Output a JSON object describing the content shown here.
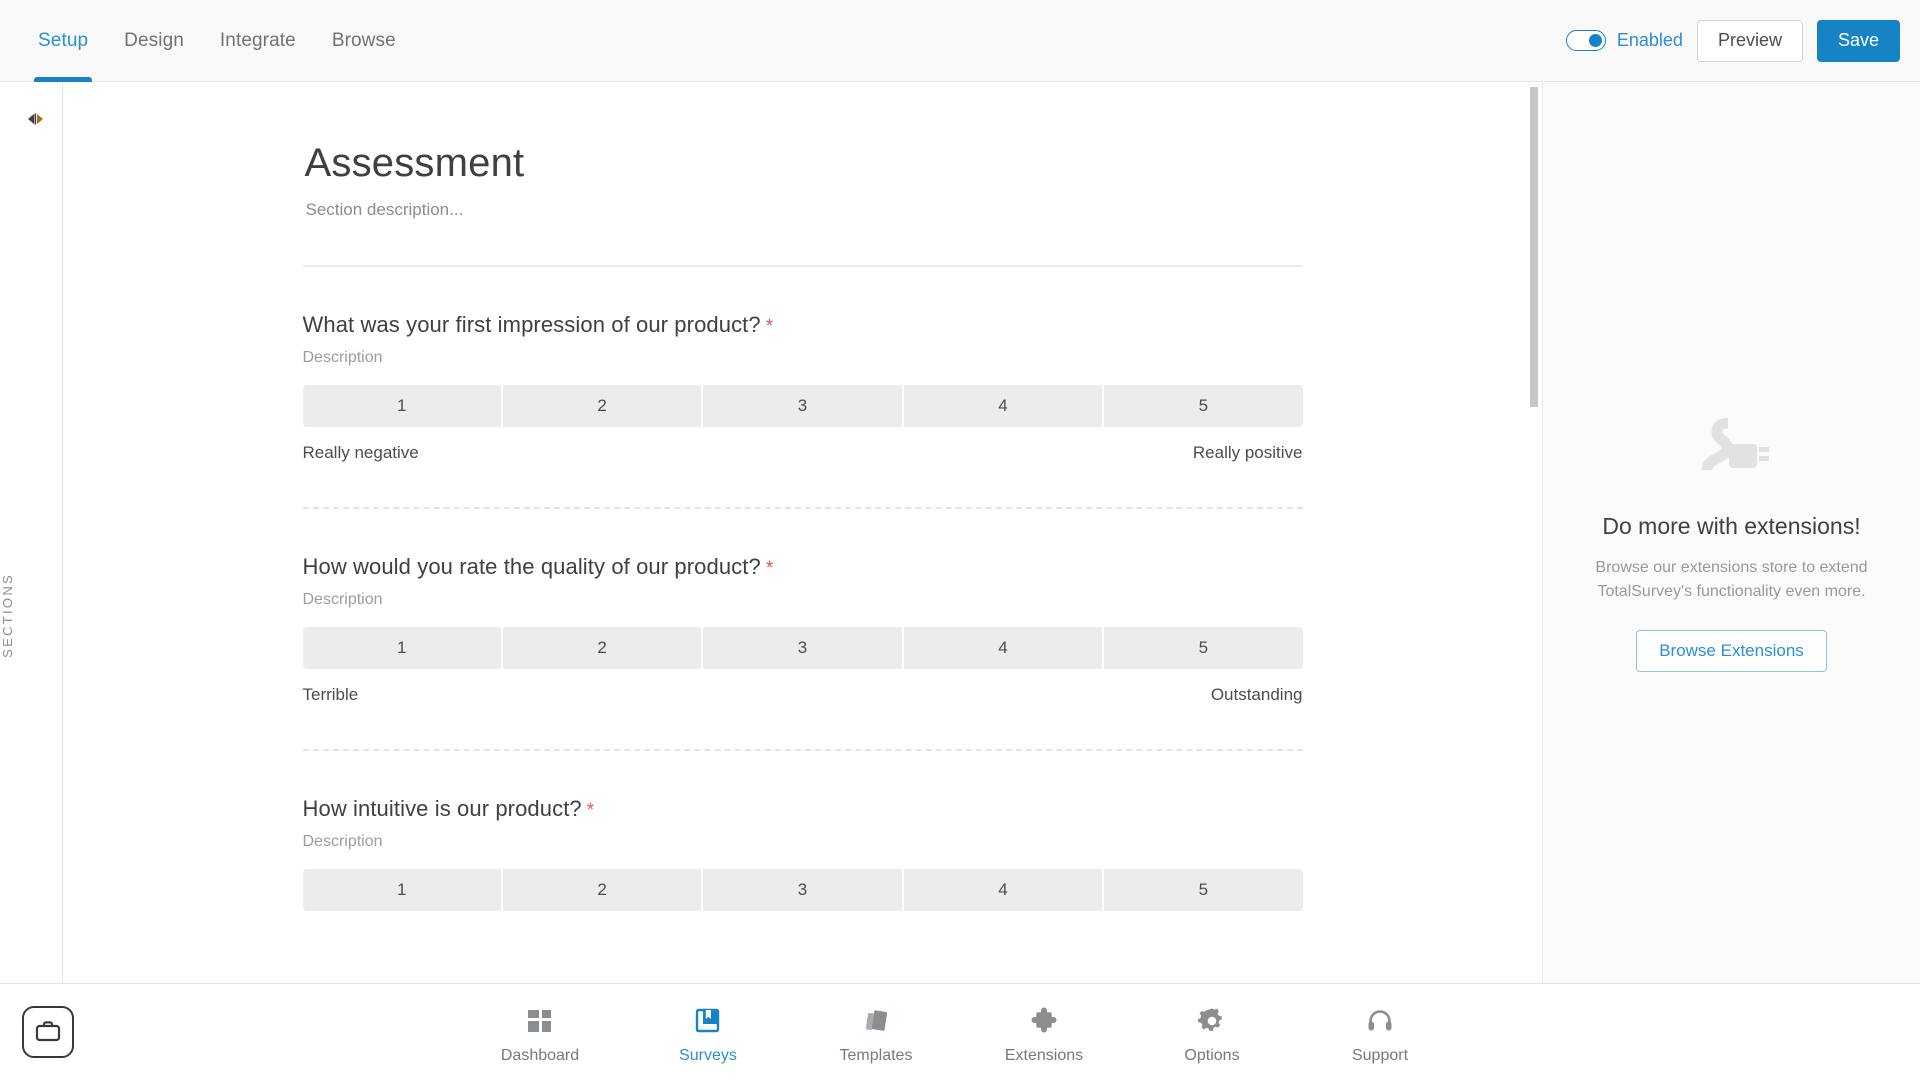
{
  "topbar": {
    "tabs": [
      {
        "label": "Setup",
        "active": true
      },
      {
        "label": "Design",
        "active": false
      },
      {
        "label": "Integrate",
        "active": false
      },
      {
        "label": "Browse",
        "active": false
      }
    ],
    "toggle_label": "Enabled",
    "toggle_state": "on",
    "preview_label": "Preview",
    "save_label": "Save",
    "accent_color": "#1683c7"
  },
  "left_rail": {
    "collapse_icon": "collapse-arrows-icon",
    "sections_label": "SECTIONS"
  },
  "section": {
    "title": "Assessment",
    "description": "Section description..."
  },
  "questions": [
    {
      "title": "What was your first impression of our product?",
      "required_mark": "*",
      "description": "Description",
      "scale": [
        "1",
        "2",
        "3",
        "4",
        "5"
      ],
      "low_label": "Really negative",
      "high_label": "Really positive"
    },
    {
      "title": "How would you rate the quality of our product?",
      "required_mark": "*",
      "description": "Description",
      "scale": [
        "1",
        "2",
        "3",
        "4",
        "5"
      ],
      "low_label": "Terrible",
      "high_label": "Outstanding"
    },
    {
      "title": "How intuitive is our product?",
      "required_mark": "*",
      "description": "Description",
      "scale": [
        "1",
        "2",
        "3",
        "4",
        "5"
      ],
      "low_label": "",
      "high_label": ""
    }
  ],
  "right_panel": {
    "icon": "plug-icon",
    "title": "Do more with extensions!",
    "description": "Browse our extensions store to extend TotalSurvey's functionality even more.",
    "button_label": "Browse Extensions"
  },
  "bottom_nav": {
    "brand_icon": "briefcase-icon",
    "items": [
      {
        "label": "Dashboard",
        "icon": "grid-icon",
        "active": false
      },
      {
        "label": "Surveys",
        "icon": "book-bookmark-icon",
        "active": true
      },
      {
        "label": "Templates",
        "icon": "templates-cards-icon",
        "active": false
      },
      {
        "label": "Extensions",
        "icon": "puzzle-piece-icon",
        "active": false
      },
      {
        "label": "Options",
        "icon": "gear-icon",
        "active": false
      },
      {
        "label": "Support",
        "icon": "headset-icon",
        "active": false
      }
    ]
  }
}
